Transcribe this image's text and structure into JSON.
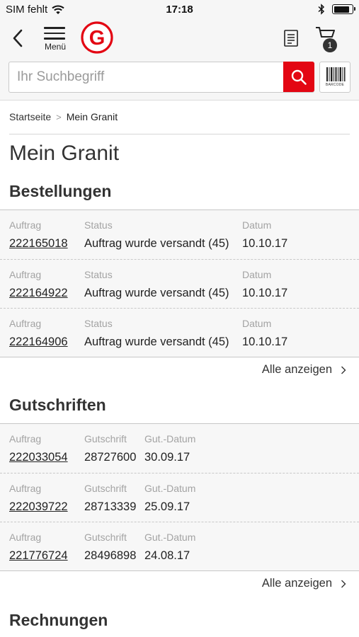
{
  "status_bar": {
    "carrier": "SIM fehlt",
    "time": "17:18",
    "battery_level": 0.9
  },
  "header": {
    "menu_label": "Menü",
    "logo_letter": "G",
    "cart_count": "1",
    "search_placeholder": "Ihr Suchbegriff",
    "barcode_label": "BARCODE",
    "icons": [
      "back-chevron",
      "hamburger-menu",
      "list",
      "cart",
      "search",
      "barcode"
    ]
  },
  "breadcrumb": {
    "home": "Startseite",
    "current": "Mein Granit"
  },
  "page_title": "Mein Granit",
  "orders": {
    "title": "Bestellungen",
    "columns": [
      "Auftrag",
      "Status",
      "Datum"
    ],
    "rows": [
      {
        "auftrag": "222165018",
        "status": "Auftrag wurde versandt (45)",
        "datum": "10.10.17"
      },
      {
        "auftrag": "222164922",
        "status": "Auftrag wurde versandt (45)",
        "datum": "10.10.17"
      },
      {
        "auftrag": "222164906",
        "status": "Auftrag wurde versandt (45)",
        "datum": "10.10.17"
      }
    ],
    "show_all": "Alle anzeigen"
  },
  "credits": {
    "title": "Gutschriften",
    "columns": [
      "Auftrag",
      "Gutschrift",
      "Gut.-Datum"
    ],
    "rows": [
      {
        "auftrag": "222033054",
        "gutschrift": "28727600",
        "datum": "30.09.17"
      },
      {
        "auftrag": "222039722",
        "gutschrift": "28713339",
        "datum": "25.09.17"
      },
      {
        "auftrag": "221776724",
        "gutschrift": "28496898",
        "datum": "24.08.17"
      }
    ],
    "show_all": "Alle anzeigen"
  },
  "invoices": {
    "title": "Rechnungen"
  },
  "colors": {
    "brand_red": "#e30613",
    "row_bg": "#f7f7f7",
    "label_gray": "#a3a3a3"
  }
}
